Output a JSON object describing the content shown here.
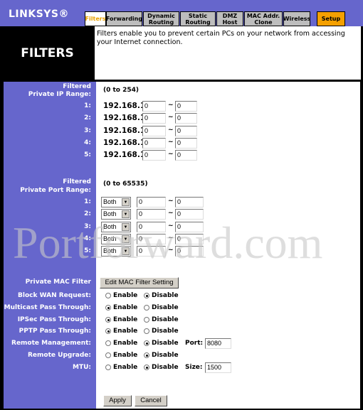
{
  "header": {
    "logo": "LINKSYS®",
    "page_title": "FILTERS",
    "description": "Filters enable you to prevent certain PCs on your network from accessing your Internet connection.",
    "tabs": [
      {
        "label": "Filters",
        "active": true
      },
      {
        "label": "Forwarding"
      },
      {
        "label": "Dynamic Routing"
      },
      {
        "label": "Static Routing"
      },
      {
        "label": "DMZ Host"
      },
      {
        "label": "MAC Addr. Clone"
      },
      {
        "label": "Wireless"
      },
      {
        "label": "Setup"
      }
    ]
  },
  "ip_range": {
    "label1": "Filtered",
    "label2": "Private IP Range:",
    "hint": "(0 to 254)",
    "prefix": "192.168.1.",
    "tilde": "~",
    "rows": [
      {
        "n": "1:",
        "from": "0",
        "to": "0"
      },
      {
        "n": "2:",
        "from": "0",
        "to": "0"
      },
      {
        "n": "3:",
        "from": "0",
        "to": "0"
      },
      {
        "n": "4:",
        "from": "0",
        "to": "0"
      },
      {
        "n": "5:",
        "from": "0",
        "to": "0"
      }
    ]
  },
  "port_range": {
    "label1": "Filtered",
    "label2": "Private Port Range:",
    "hint": "(0 to 65535)",
    "tilde": "~",
    "rows": [
      {
        "n": "1:",
        "proto": "Both",
        "from": "0",
        "to": "0"
      },
      {
        "n": "2:",
        "proto": "Both",
        "from": "0",
        "to": "0"
      },
      {
        "n": "3:",
        "proto": "Both",
        "from": "0",
        "to": "0"
      },
      {
        "n": "4:",
        "proto": "Both",
        "from": "0",
        "to": "0"
      },
      {
        "n": "5:",
        "proto": "Both",
        "from": "0",
        "to": "0"
      }
    ]
  },
  "mac_filter": {
    "label": "Private MAC Filter",
    "button": "Edit MAC Filter Setting"
  },
  "options": {
    "enable": "Enable",
    "disable": "Disable",
    "rows": [
      {
        "label": "Block WAN Request:",
        "value": "Disable"
      },
      {
        "label": "Multicast Pass Through:",
        "value": "Enable"
      },
      {
        "label": "IPSec Pass Through:",
        "value": "Enable"
      },
      {
        "label": "PPTP Pass Through:",
        "value": "Enable"
      },
      {
        "label": "Remote Management:",
        "value": "Disable",
        "extra_label": "Port:",
        "extra_value": "8080"
      },
      {
        "label": "Remote Upgrade:",
        "value": "Disable"
      },
      {
        "label": "MTU:",
        "value": "Disable",
        "extra_label": "Size:",
        "extra_value": "1500"
      }
    ]
  },
  "actions": {
    "apply": "Apply",
    "cancel": "Cancel"
  },
  "watermark": "Portforward.com",
  "colors": {
    "purple": "#6666cc",
    "setup_tab": "#f5a000",
    "active_tab_text": "#e8a000"
  }
}
